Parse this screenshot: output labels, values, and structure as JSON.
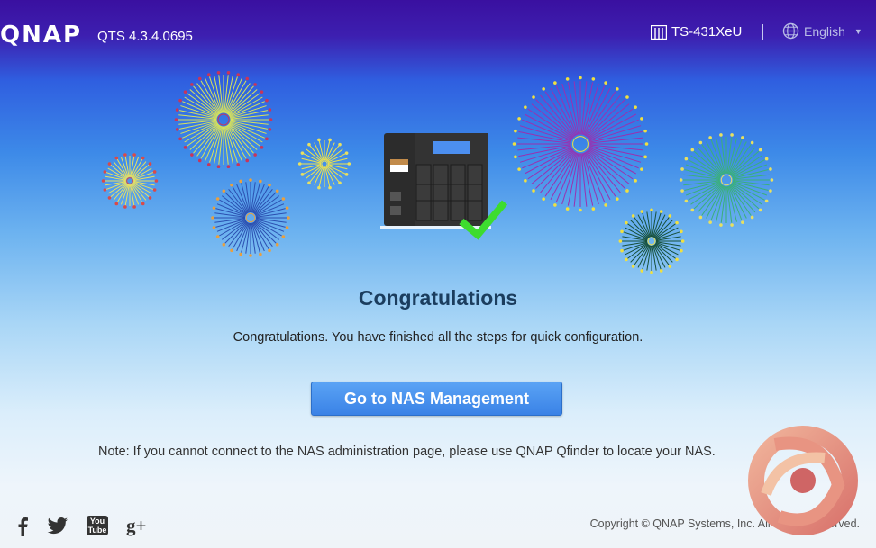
{
  "header": {
    "logo": "QNAP",
    "version": "QTS 4.3.4.0695",
    "model": "TS-431XeU",
    "language": "English"
  },
  "main": {
    "title": "Congratulations",
    "message": "Congratulations. You have finished all the steps for quick configuration.",
    "button_label": "Go to NAS Management",
    "note": "Note: If you cannot connect to the NAS administration page, please use QNAP Qfinder to locate your NAS."
  },
  "footer": {
    "social": [
      "facebook-icon",
      "twitter-icon",
      "youtube-icon",
      "googleplus-icon"
    ],
    "youtube_text": "You Tube",
    "googleplus_text": "g+",
    "copyright": "Copyright © QNAP Systems, Inc. All Rights Reserved."
  },
  "colors": {
    "button": "#3a82e6",
    "title": "#1b3d5e",
    "check": "#3ddc2f"
  }
}
